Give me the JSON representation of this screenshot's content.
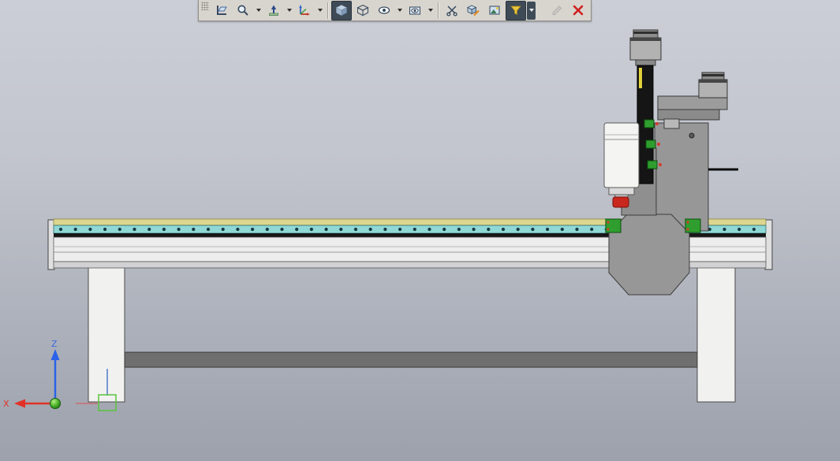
{
  "viewport": {
    "background_top": "#cbced6",
    "background_bottom": "#9da1ac",
    "description": "CAD graphics area showing a CNC router machine, side view"
  },
  "toolbar": {
    "background": "#d8d5ce",
    "active_background": "#3e4b57",
    "items": [
      {
        "id": "drag-handle",
        "icon": "grip-dots-icon",
        "type": "handle"
      },
      {
        "id": "sketch-plane",
        "icon": "plane-ruler-icon",
        "type": "button"
      },
      {
        "id": "zoom",
        "icon": "magnifier-icon",
        "type": "button",
        "has_dropdown": true
      },
      {
        "id": "view-normal-to",
        "icon": "up-arrow-plane-icon",
        "type": "button",
        "has_dropdown": true
      },
      {
        "id": "view-orientation",
        "icon": "axes-icon",
        "type": "button",
        "has_dropdown": true
      },
      {
        "id": "display-style-shaded",
        "icon": "shaded-cube-icon",
        "type": "button",
        "state": "active"
      },
      {
        "id": "display-style-wireframe",
        "icon": "wireframe-cube-icon",
        "type": "button"
      },
      {
        "id": "hide-show-items",
        "icon": "eye-icon",
        "type": "button",
        "has_dropdown": true
      },
      {
        "id": "view-settings",
        "icon": "eye-box-icon",
        "type": "button",
        "has_dropdown": true
      },
      {
        "id": "section-view",
        "icon": "scissors-icon",
        "type": "button"
      },
      {
        "id": "edit-view",
        "icon": "cube-pencil-icon",
        "type": "button"
      },
      {
        "id": "apply-scene",
        "icon": "scene-icon",
        "type": "button"
      },
      {
        "id": "selection-filter",
        "icon": "funnel-icon",
        "type": "button",
        "state": "active",
        "has_dropdown": true
      },
      {
        "id": "edit-sketch",
        "icon": "pencil-icon",
        "type": "button",
        "state": "disabled"
      },
      {
        "id": "cancel",
        "icon": "red-x-icon",
        "type": "button"
      }
    ]
  },
  "triad": {
    "z_label": "Z",
    "x_label": "X",
    "z_color": "#3a6ae0",
    "x_color": "#e03226",
    "origin_color": "#4db32c"
  },
  "model": {
    "parts": [
      "table-bed",
      "left-leg",
      "right-leg",
      "cross-brace",
      "gantry-plate",
      "z-column",
      "z-motor",
      "y-motor",
      "spindle",
      "tool-tip",
      "linear-guide-blocks"
    ],
    "colors": {
      "table_top_strip": "#ddd68f",
      "table_rail_strip": "#8fd8d6",
      "table_body": "#ededee",
      "frame_legs": "#f1f1f0",
      "cross_brace": "#6f6f6f",
      "gantry": "#979797",
      "column": "#151515",
      "spindle_body": "#f4f4f3",
      "tool_tip": "#c9281e",
      "guide_block": "#2f9e2f"
    }
  }
}
